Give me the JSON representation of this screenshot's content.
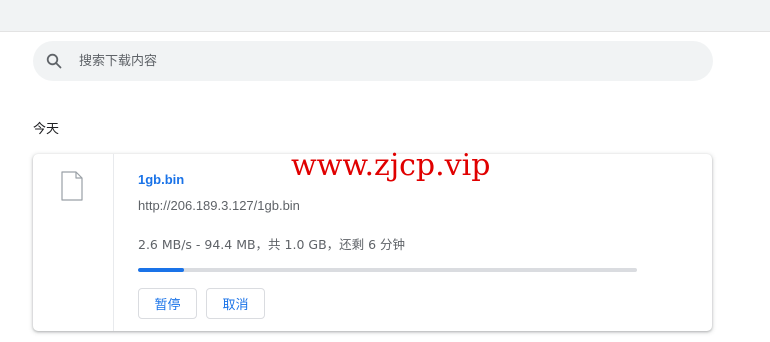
{
  "search": {
    "placeholder": "搜索下载内容",
    "value": ""
  },
  "section": {
    "heading": "今天"
  },
  "download": {
    "file_name": "1gb.bin",
    "url": "http://206.189.3.127/1gb.bin",
    "status": "2.6 MB/s - 94.4 MB，共 1.0 GB，还剩 6 分钟",
    "progress_fraction": 0.092,
    "buttons": {
      "pause": "暂停",
      "cancel": "取消"
    }
  },
  "watermark": "www.zjcp.vip",
  "colors": {
    "accent": "#1a73e8",
    "watermark": "#e00000",
    "search_background": "#f1f3f4",
    "progress_track": "#dadce0"
  },
  "icons": {
    "search": "search-icon",
    "file": "file-icon"
  }
}
